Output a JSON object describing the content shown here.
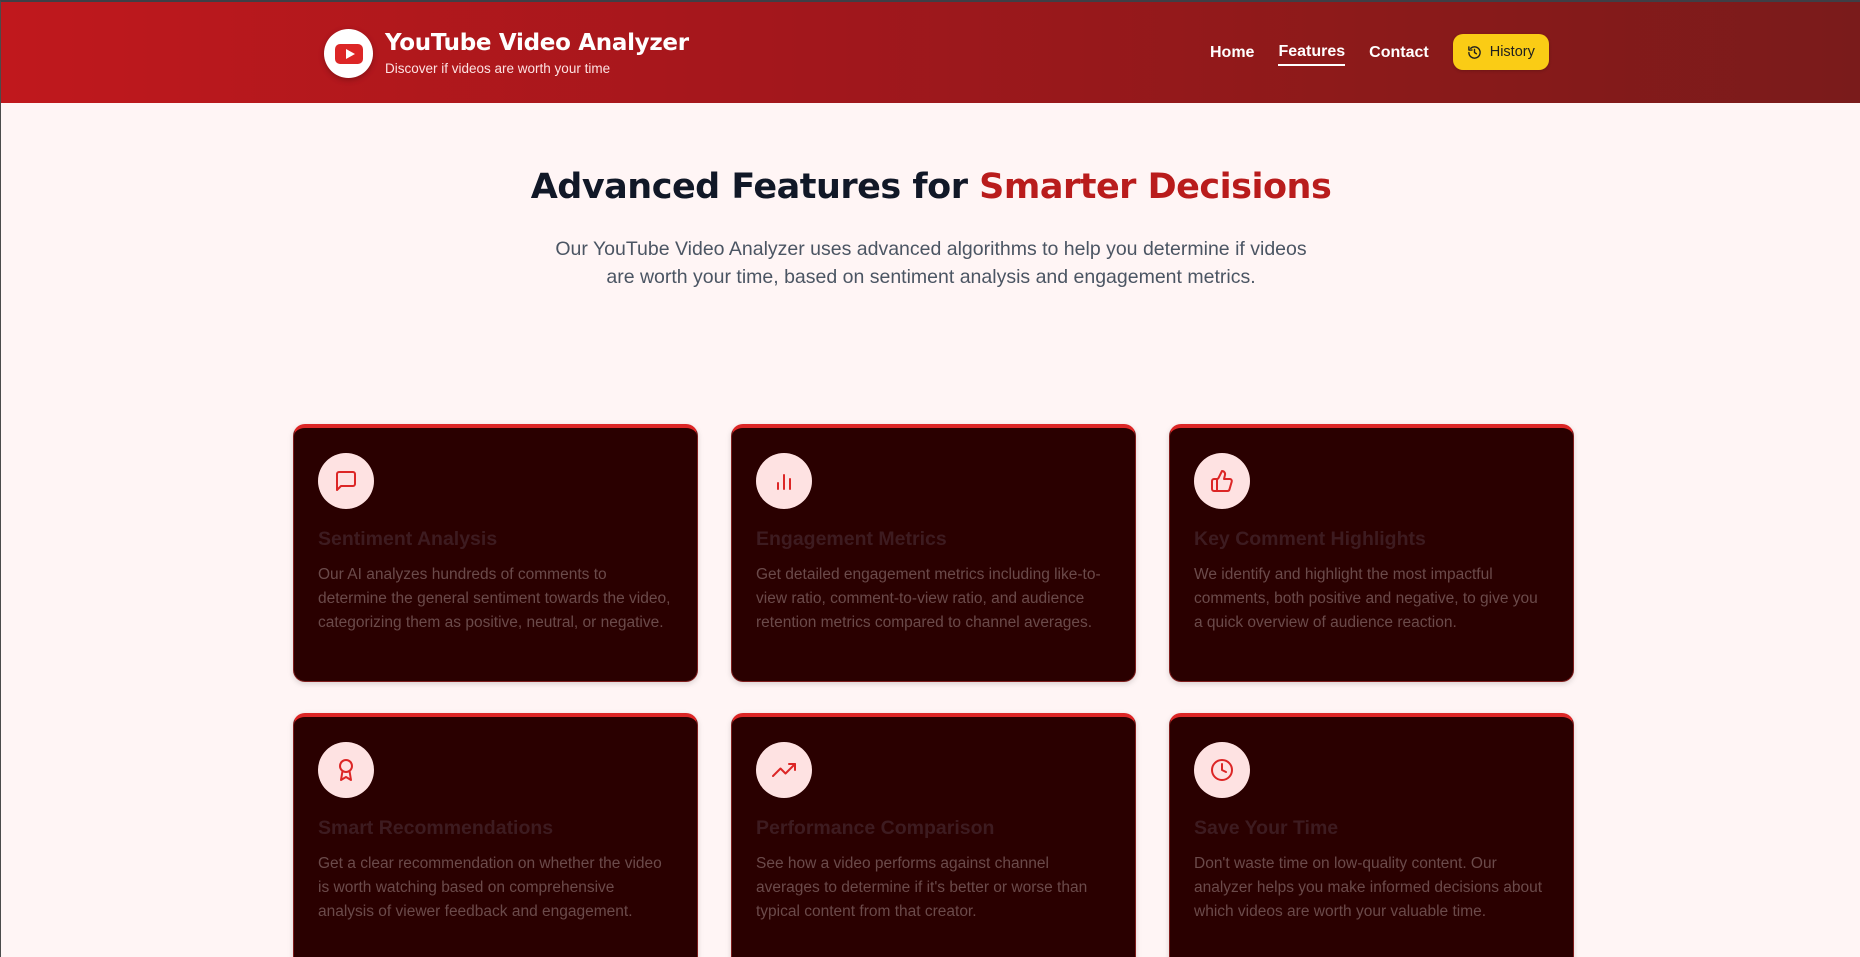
{
  "brand": {
    "title": "YouTube Video Analyzer",
    "subtitle": "Discover if videos are worth your time",
    "logo_icon": "youtube-play-icon"
  },
  "nav": {
    "items": [
      {
        "label": "Home",
        "active": false
      },
      {
        "label": "Features",
        "active": true
      },
      {
        "label": "Contact",
        "active": false
      }
    ],
    "history_label": "History",
    "history_icon": "history-icon"
  },
  "hero": {
    "title_main": "Advanced Features for ",
    "title_accent": "Smarter Decisions",
    "description": "Our YouTube Video Analyzer uses advanced algorithms to help you determine if videos are worth your time, based on sentiment analysis and engagement metrics."
  },
  "features": [
    {
      "icon": "message-square-icon",
      "title": "Sentiment Analysis",
      "description": "Our AI analyzes hundreds of comments to determine the general sentiment towards the video, categorizing them as positive, neutral, or negative."
    },
    {
      "icon": "bar-chart-icon",
      "title": "Engagement Metrics",
      "description": "Get detailed engagement metrics including like-to-view ratio, comment-to-view ratio, and audience retention metrics compared to channel averages."
    },
    {
      "icon": "thumbs-up-icon",
      "title": "Key Comment Highlights",
      "description": "We identify and highlight the most impactful comments, both positive and negative, to give you a quick overview of audience reaction."
    },
    {
      "icon": "award-icon",
      "title": "Smart Recommendations",
      "description": "Get a clear recommendation on whether the video is worth watching based on comprehensive analysis of viewer feedback and engagement."
    },
    {
      "icon": "trending-up-icon",
      "title": "Performance Comparison",
      "description": "See how a video performs against channel averages to determine if it's better or worse than typical content from that creator."
    },
    {
      "icon": "clock-icon",
      "title": "Save Your Time",
      "description": "Don't waste time on low-quality content. Our analyzer helps you make informed decisions about which videos are worth your valuable time."
    }
  ],
  "colors": {
    "header_start": "#c0181d",
    "header_end": "#7a1b1b",
    "accent_red": "#b91c1c",
    "history_button": "#facc15",
    "card_background": "#2a0000",
    "card_top_border": "#dc2626",
    "icon_circle": "#fee2e2"
  }
}
